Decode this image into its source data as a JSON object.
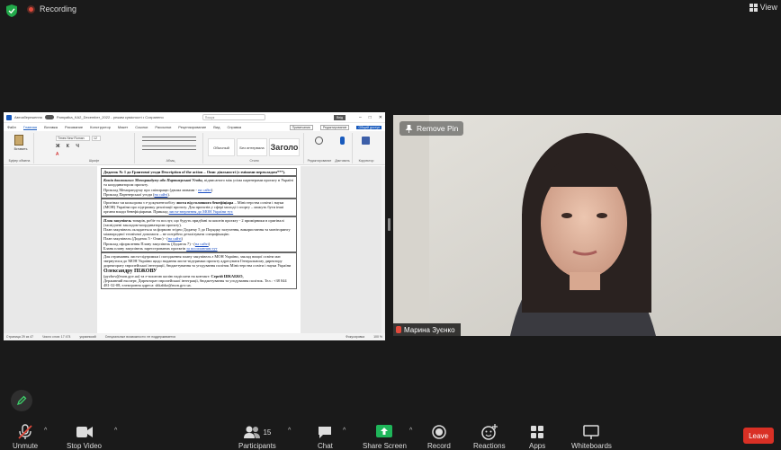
{
  "topbar": {
    "recording_label": "Recording",
    "view_label": "View"
  },
  "word": {
    "autosave_label": "Автозбереження",
    "file_name": "Pamyatka_KA2_December_2022 - режим сумісності • Сохранено",
    "search_placeholder": "Пошук",
    "login_label": "Вхід",
    "menu": [
      "Файл",
      "Главная",
      "Вставка",
      "Рисование",
      "Конструктор",
      "Макет",
      "Ссылки",
      "Рассылки",
      "Рецензирование",
      "Вид",
      "Справка"
    ],
    "comments_label": "Примечания",
    "editing_label": "Редактирование",
    "share_label": "Общий доступ",
    "font_name": "Times New Roman",
    "font_size": "12",
    "ribbon_groups": [
      "Буфер обмена",
      "Шрифт",
      "Абзац",
      "Стили",
      "Редактирование",
      "Диктовать",
      "Корректор"
    ],
    "styles": [
      "Обычный",
      "Без интервала",
      "Заголо"
    ],
    "paste_label": "Вставить",
    "status": [
      "Страница 29 из 47",
      "Число слов: 17 474",
      "украинский",
      "Специальные возможности: не поддерживается",
      "Фокусировка",
      "100 %"
    ]
  },
  "document": {
    "p1": "Додаток № 1 до Грантової угоди Description of the action – Опис діяльності (з змінами перекладом***).",
    "p2_b": "Копія двомовного Меморандуму або Партнерської Угоди,",
    "p2": "підписаного між усіма партнерами проєкту в Україні та координатором проєкту.",
    "p3": "Приклад Меморандуму про співпрацю (двома мовами -",
    "p3_link": "на сайті",
    "p4": "Приклад Партнерської угоди",
    "p4_link": "на сайті",
    "p5_a": "Оригінал чи кольорова з е-документообігу",
    "p5_b": "листа від головного бенефіціара",
    "p5": "– Міністерства освіти і науки (МОН) України про підтримку реалізації проєкту. Для проєктів у сфері молоді і спорту – можуть бути інші органи влади бенефіціарами. Приклад",
    "p5_link": "листа-звернення до МОН України тут.",
    "p6_b": "План закупівель",
    "p6": "товарів, робіт та послуг, що будуть придбані за коштів проєкту - 2 примірники в оригіналі (засвідчені закладом-координатором проєкту).",
    "p7": "План закупівель складається за формою згідно Додатку 5 до Порядку залучення, використання та моніторингу міжнародної технічної допомоги – не потрібно деталізувати специфікацію.",
    "p8": "План закупівель (Додаток 5 - Опис) -",
    "p8_link": "на сайті",
    "p9": "Приклад оформлення Плану закупівель (Додаток 7) -",
    "p9_link": "на сайті",
    "p10": "Бланк плану закупівель зареєстрованих проєктів",
    "p10_link": "за посиланням тут",
    "p11": "Для отримання листа-підтримки і погодження плану закупівель з МОН України, заклад вищої освіти має звернутися до МОН України щодо надання листа-підтримки проєкту адресувати Генеральному директору директорату європейської інтеграції, бюджетування та угодування політик Міністерства освіти і науки України",
    "p11_b": "Олександру ПІЖОВУ",
    "p12": "(pyzhov@mon.gov.ua) та е-поштою копію надіслати на контакт:",
    "p12_b": "Сергій ШКАБКО,",
    "p13": "Державний експерт, Директорат європейської інтеграції, бюджетування та угодування політик. Тел.: +38 044 481-32-08, електронна адреса: shkabko@mon.gov.ua."
  },
  "video": {
    "remove_pin_label": "Remove Pin",
    "participant_name": "Марина Зуєнко"
  },
  "toolbar": {
    "unmute": "Unmute",
    "stop_video": "Stop Video",
    "participants": "Participants",
    "participants_count": "15",
    "chat": "Chat",
    "share_screen": "Share Screen",
    "record": "Record",
    "reactions": "Reactions",
    "apps": "Apps",
    "whiteboards": "Whiteboards",
    "leave": "Leave"
  },
  "colors": {
    "leave": "#d93025",
    "share_green": "#1fb65a",
    "word_blue": "#185abd",
    "recording_red": "#e24a3c"
  }
}
